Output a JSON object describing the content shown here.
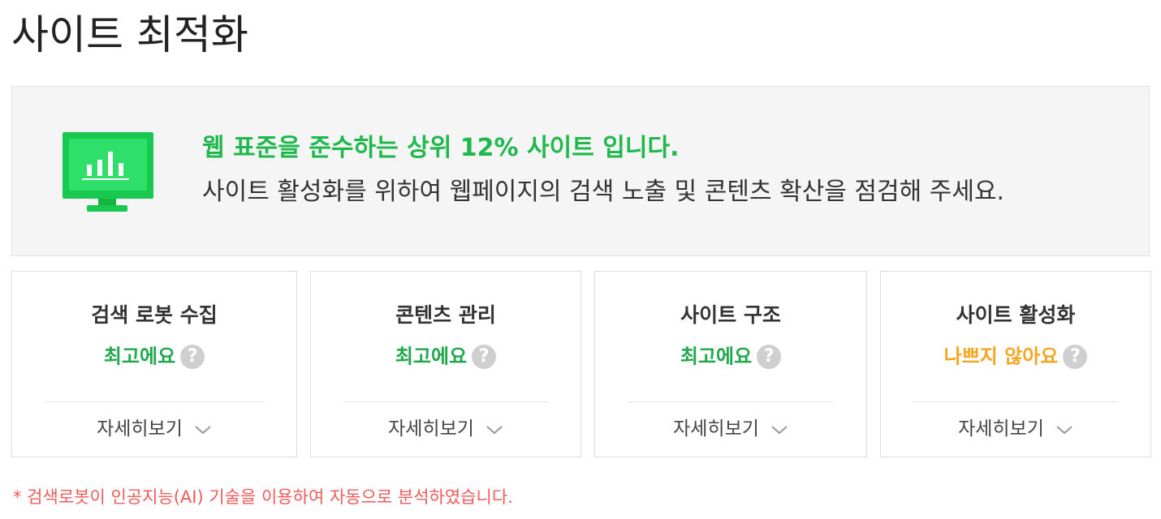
{
  "page": {
    "title": "사이트 최적화"
  },
  "summary": {
    "icon": "monitor-chart-icon",
    "headline": "웹 표준을 준수하는 상위 12% 사이트 입니다.",
    "description": "사이트 활성화를 위하여 웹페이지의 검색 노출 및 콘텐츠 확산을 점검해 주세요.",
    "accent_color": "#1fb84c"
  },
  "cards": [
    {
      "title": "검색 로봇 수집",
      "status": "최고에요",
      "status_type": "good",
      "help_icon": "question-icon",
      "detail_label": "자세히보기"
    },
    {
      "title": "콘텐츠 관리",
      "status": "최고에요",
      "status_type": "good",
      "help_icon": "question-icon",
      "detail_label": "자세히보기"
    },
    {
      "title": "사이트 구조",
      "status": "최고에요",
      "status_type": "good",
      "help_icon": "question-icon",
      "detail_label": "자세히보기"
    },
    {
      "title": "사이트 활성화",
      "status": "나쁘지 않아요",
      "status_type": "fair",
      "help_icon": "question-icon",
      "detail_label": "자세히보기"
    }
  ],
  "colors": {
    "good": "#1fa84c",
    "fair": "#f5a623",
    "footnote": "#ef5b5b"
  },
  "footnote": "* 검색로봇이 인공지능(AI) 기술을 이용하여 자동으로 분석하였습니다."
}
